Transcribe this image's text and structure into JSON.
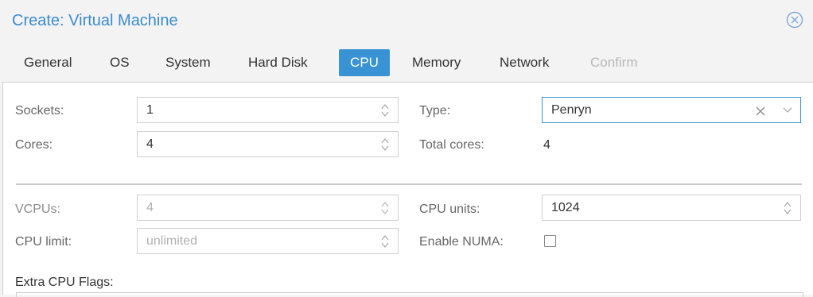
{
  "dialog": {
    "title": "Create: Virtual Machine"
  },
  "tabs": [
    {
      "label": "General",
      "state": "normal"
    },
    {
      "label": "OS",
      "state": "normal"
    },
    {
      "label": "System",
      "state": "normal"
    },
    {
      "label": "Hard Disk",
      "state": "normal"
    },
    {
      "label": "CPU",
      "state": "active"
    },
    {
      "label": "Memory",
      "state": "normal"
    },
    {
      "label": "Network",
      "state": "normal"
    },
    {
      "label": "Confirm",
      "state": "disabled"
    }
  ],
  "cpu": {
    "sockets": {
      "label": "Sockets:",
      "value": "1"
    },
    "cores": {
      "label": "Cores:",
      "value": "4"
    },
    "type": {
      "label": "Type:",
      "value": "Penryn",
      "clear_icon": "clear-icon",
      "dropdown_icon": "chevron-down-icon"
    },
    "total_cores": {
      "label": "Total cores:",
      "value": "4"
    },
    "vcpus": {
      "label": "VCPUs:",
      "value": "4"
    },
    "cpu_units": {
      "label": "CPU units:",
      "value": "1024"
    },
    "cpu_limit": {
      "label": "CPU limit:",
      "value": "unlimited"
    },
    "enable_numa": {
      "label": "Enable NUMA:",
      "checked": false
    },
    "extra_flags": {
      "label": "Extra CPU Flags:"
    }
  },
  "colors": {
    "accent": "#3892d4",
    "title": "#3a8bd0"
  }
}
